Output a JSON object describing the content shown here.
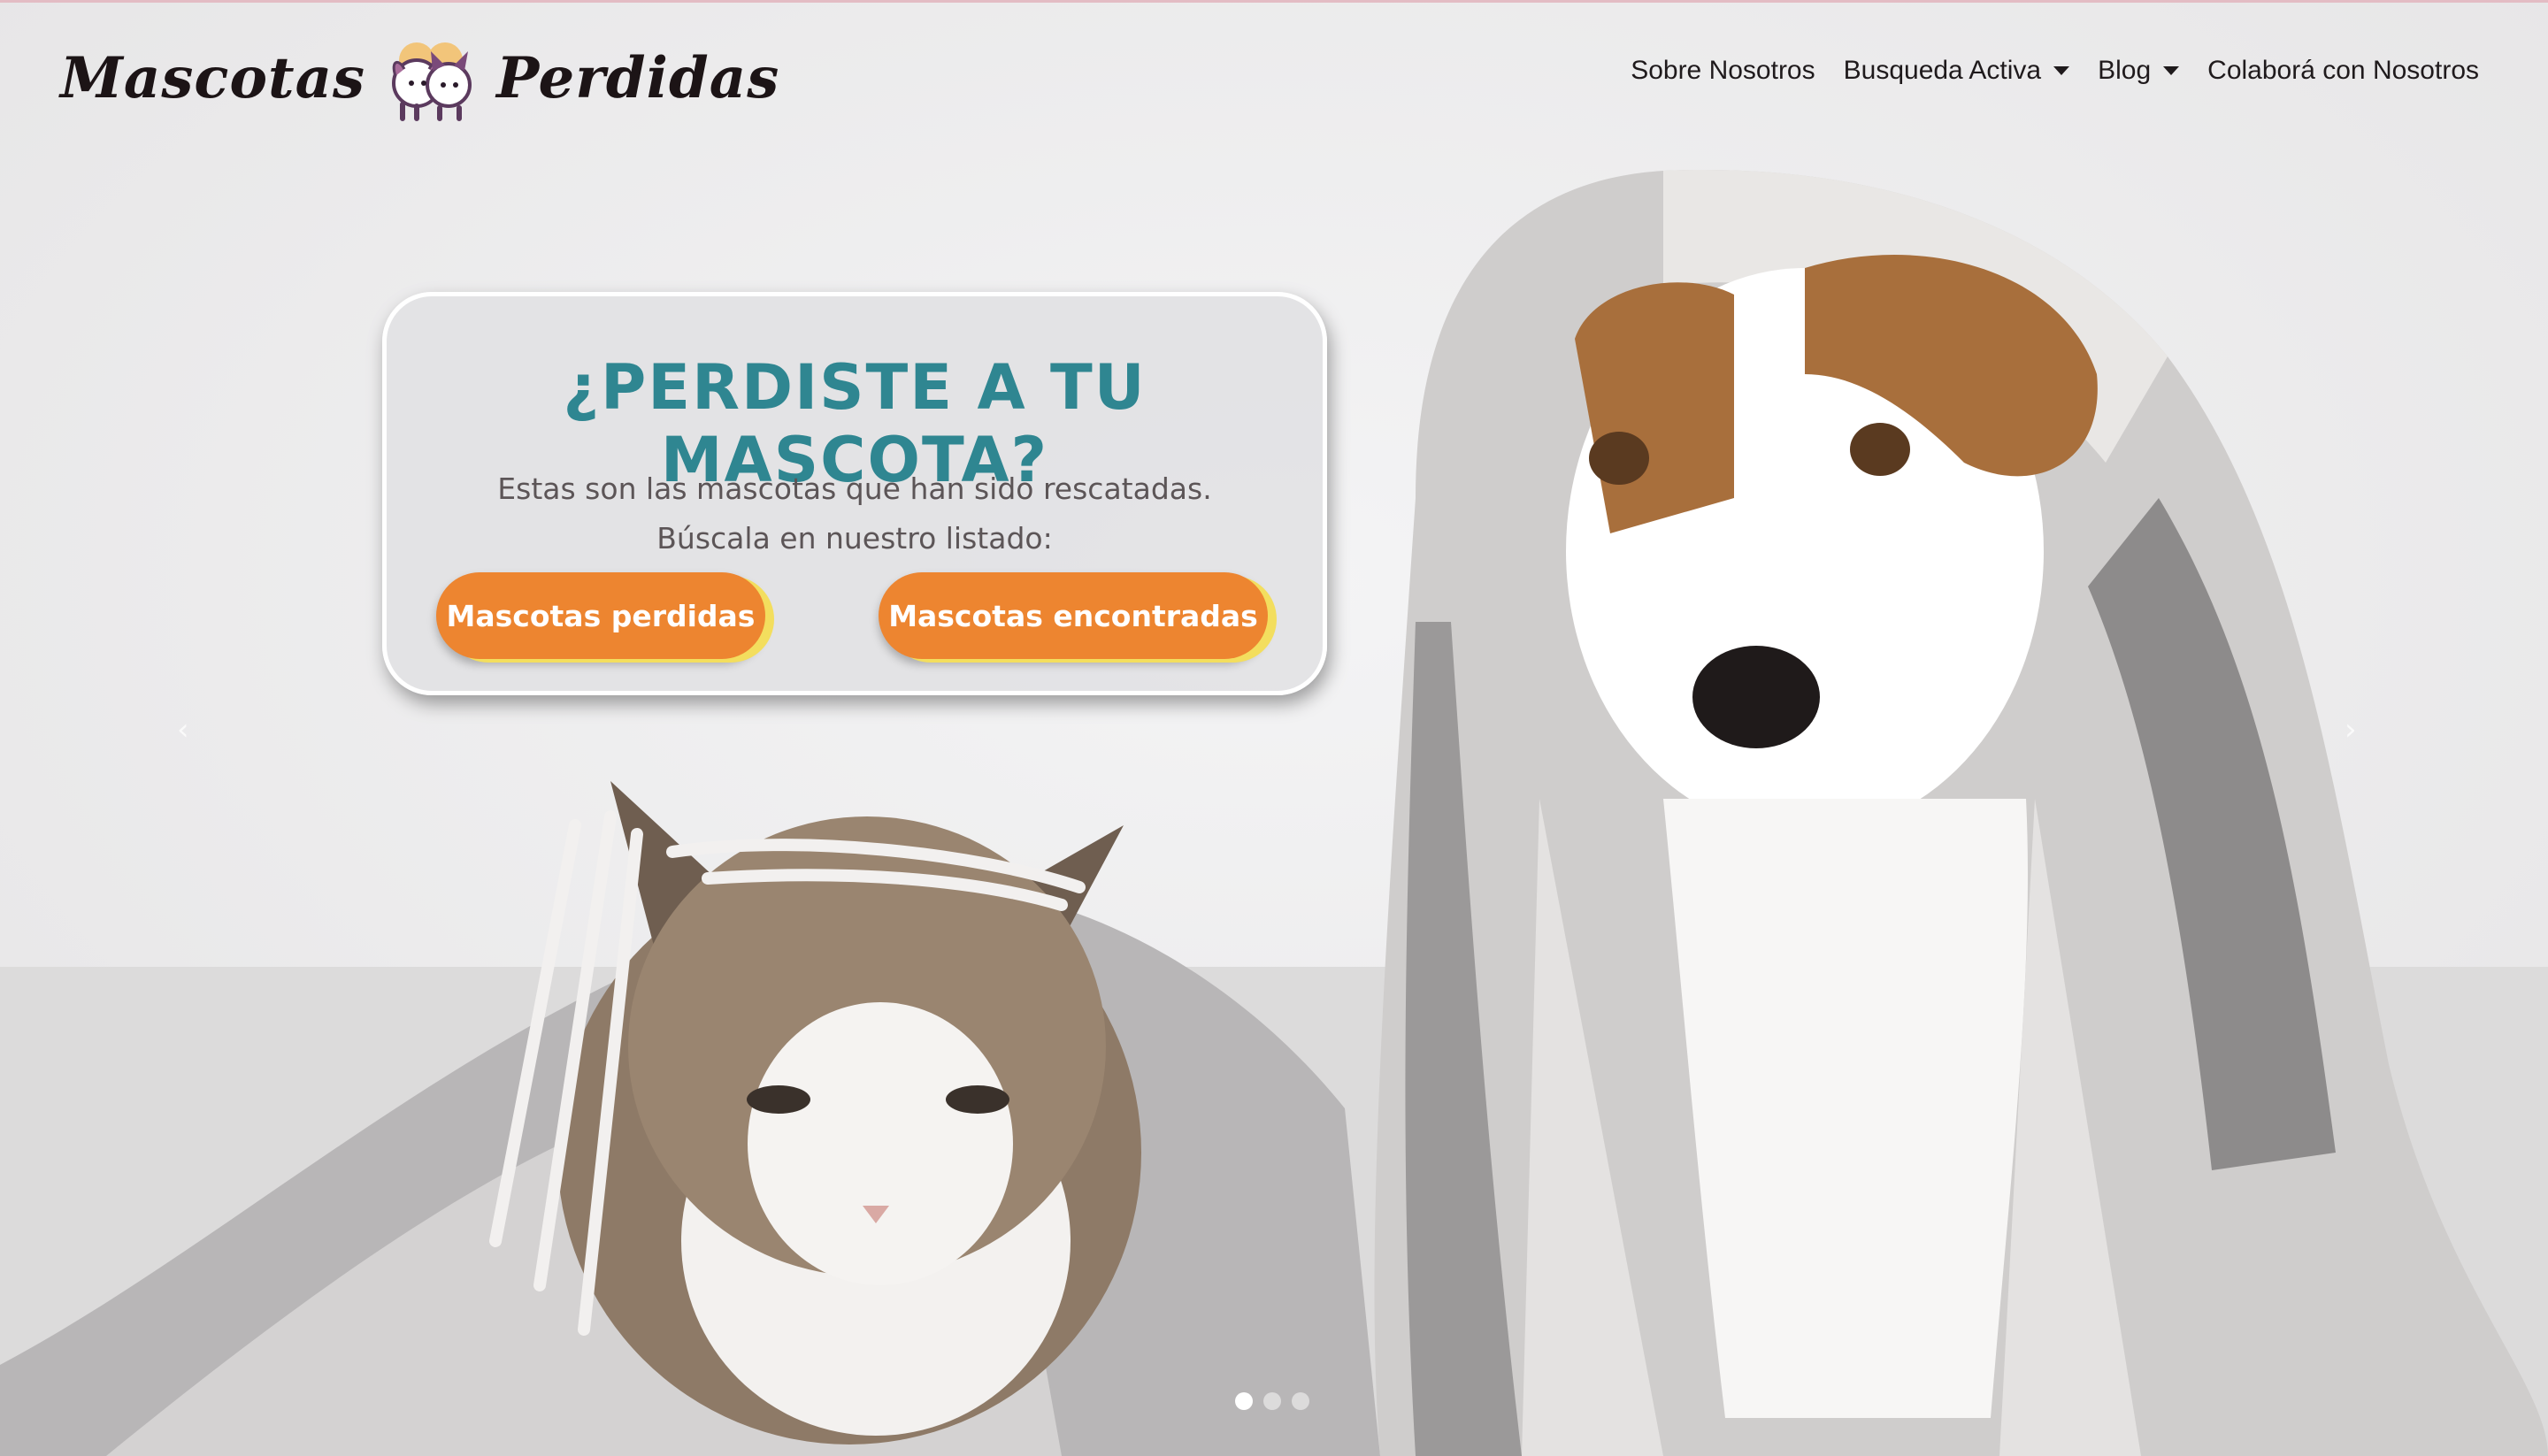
{
  "brand": {
    "word_left": "Mascotas",
    "word_right": "Perdidas",
    "logo_icon": "cat-and-dog-logo-icon"
  },
  "nav": {
    "items": [
      {
        "label": "Sobre Nosotros",
        "dropdown": false
      },
      {
        "label": "Busqueda Activa",
        "dropdown": true
      },
      {
        "label": "Blog",
        "dropdown": true
      },
      {
        "label": "Colaborá con Nosotros",
        "dropdown": false
      }
    ]
  },
  "hero": {
    "title": "¿PERDISTE A TU MASCOTA?",
    "text_line1": "Estas son las mascotas que han sido rescatadas.",
    "text_line2": "Búscala en nuestro listado:",
    "button_lost": "Mascotas perdidas",
    "button_found": "Mascotas encontradas"
  },
  "carousel": {
    "prev_icon": "chevron-left-icon",
    "next_icon": "chevron-right-icon",
    "prev_glyph": "‹",
    "next_glyph": "›",
    "slide_count": 3,
    "active_index": 0
  },
  "colors": {
    "title": "#2f8691",
    "button": "#ed8530",
    "button_accent": "#f3de5e",
    "nav_text": "#1f1a1c"
  }
}
